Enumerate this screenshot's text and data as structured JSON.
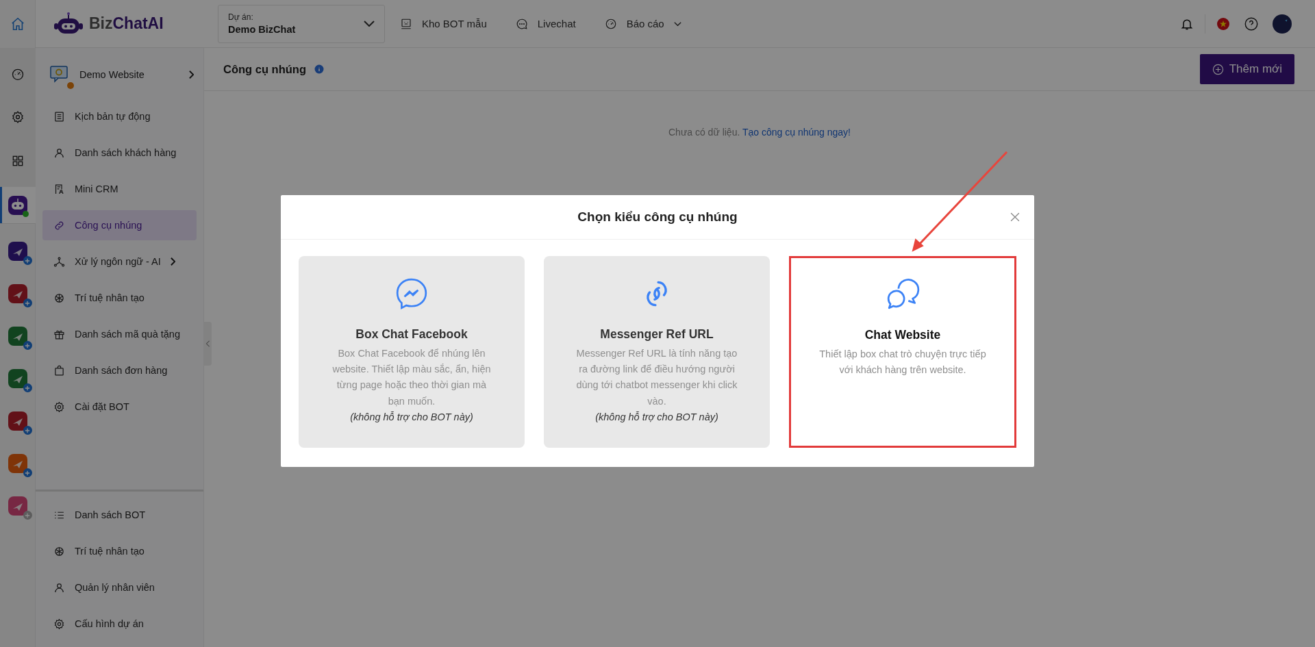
{
  "logo": {
    "first": "Biz",
    "second": "ChatAI"
  },
  "project": {
    "label": "Dự án:",
    "value": "Demo BizChat"
  },
  "nav": [
    {
      "kind": "robot",
      "label": "Kho BOT mẫu",
      "has_dropdown": false
    },
    {
      "kind": "chat",
      "label": "Livechat",
      "has_dropdown": false
    },
    {
      "kind": "gauge",
      "label": "Báo cáo",
      "has_dropdown": true
    }
  ],
  "rail": {
    "bot_selected": true,
    "bot_online": true,
    "apps": [
      {
        "connected": true
      },
      {
        "connected": true
      },
      {
        "connected": true
      },
      {
        "connected": true
      },
      {
        "connected": true
      },
      {
        "connected": true
      },
      {
        "connected": false
      }
    ]
  },
  "sidebar": {
    "header": {
      "title": "Demo Website"
    },
    "items": [
      {
        "kind": "list",
        "label": "Kịch bản tự động",
        "selected": false,
        "has_submenu": false
      },
      {
        "kind": "user",
        "label": "Danh sách khách hàng",
        "selected": false,
        "has_submenu": false
      },
      {
        "kind": "crm",
        "label": "Mini CRM",
        "selected": false,
        "has_submenu": false
      },
      {
        "kind": "link",
        "label": "Công cụ nhúng",
        "selected": true,
        "has_submenu": false
      },
      {
        "kind": "nodes",
        "label": "Xử lý ngôn ngữ - AI",
        "selected": false,
        "has_submenu": true
      },
      {
        "kind": "ai",
        "label": "Trí tuệ nhân tạo",
        "selected": false,
        "has_submenu": false
      },
      {
        "kind": "gift",
        "label": "Danh sách mã quà tặng",
        "selected": false,
        "has_submenu": false
      },
      {
        "kind": "bag",
        "label": "Danh sách đơn hàng",
        "selected": false,
        "has_submenu": false
      },
      {
        "kind": "gear",
        "label": "Cài đặt BOT",
        "selected": false,
        "has_submenu": false
      }
    ],
    "bottom_items": [
      {
        "kind": "bullets",
        "label": "Danh sách BOT",
        "selected": false
      },
      {
        "kind": "ai",
        "label": "Trí tuệ nhân tạo",
        "selected": false
      },
      {
        "kind": "user",
        "label": "Quản lý nhân viên",
        "selected": false
      },
      {
        "kind": "gear",
        "label": "Cấu hình dự án",
        "selected": false
      }
    ]
  },
  "page": {
    "title": "Công cụ nhúng",
    "add_button": "Thêm mới",
    "empty_text": "Chưa có dữ liệu.",
    "empty_link": "Tạo công cụ nhúng ngay!"
  },
  "modal": {
    "title": "Chọn kiểu công cụ nhúng",
    "options": [
      {
        "kind": "messenger",
        "title": "Box Chat Facebook",
        "description": "Box Chat Facebook để nhúng lên website. Thiết lập màu sắc, ẩn, hiện từng page hoặc theo thời gian mà bạn muốn.",
        "note": "(không hỗ trợ cho BOT này)",
        "disabled": true,
        "highlighted": false
      },
      {
        "kind": "link",
        "title": "Messenger Ref URL",
        "description": "Messenger Ref URL là tính năng tạo ra đường link để điều hướng người dùng tới chatbot messenger khi click vào.",
        "note": "(không hỗ trợ cho BOT này)",
        "disabled": true,
        "highlighted": false
      },
      {
        "kind": "chats",
        "title": "Chat Website",
        "description": "Thiết lập box chat trò chuyện trực tiếp với khách hàng trên website.",
        "disabled": false,
        "highlighted": true
      }
    ]
  }
}
